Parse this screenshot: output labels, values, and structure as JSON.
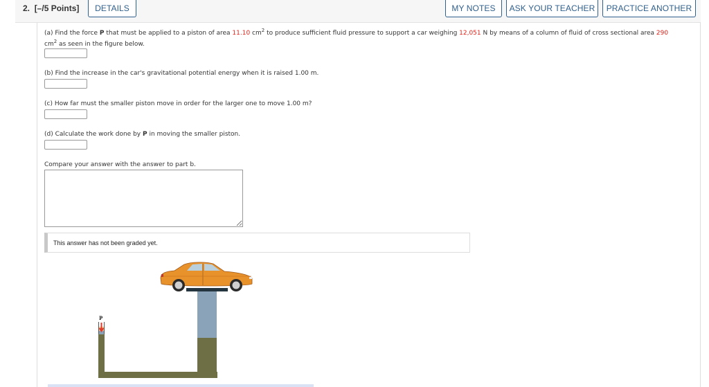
{
  "header": {
    "question_number": "2.",
    "points": "[–/5 Points]",
    "buttons": {
      "details": "DETAILS",
      "my_notes": "MY NOTES",
      "ask_teacher": "ASK YOUR TEACHER",
      "practice_another": "PRACTICE ANOTHER"
    }
  },
  "colors": {
    "accent": "#2f5f8c",
    "highlight_value": "#e2231a"
  },
  "question": {
    "part_a": {
      "t1": "(a) Find the force ",
      "bold_p": "P",
      "t2": " that must be applied to a piston of area ",
      "area_small": "11.10",
      "t3": " cm",
      "sup": "2",
      "t4": " to produce sufficient fluid pressure to support a car weighing ",
      "weight": "12,051",
      "t5": " N by means of a column of fluid of cross sectional area ",
      "area_large": "290",
      "t6": "cm",
      "sup2": "2",
      "t7": " as seen in the figure below."
    },
    "part_b": "(b) Find the increase in the car's gravitational potential energy when it is raised 1.00 m.",
    "part_c": "(c) How far must the smaller piston move in order for the larger one to move 1.00 m?",
    "part_d_1": "(d) Calculate the work done by ",
    "part_d_bold": "P",
    "part_d_2": " in moving the smaller piston.",
    "compare": "Compare your answer with the answer to part b.",
    "answers": {
      "a": "",
      "b": "",
      "c": "",
      "d": "",
      "compare": ""
    },
    "graded_status": "This answer has not been graded yet."
  },
  "figure": {
    "force_label": "P",
    "icon": "hydraulic-lift-car-figure"
  }
}
